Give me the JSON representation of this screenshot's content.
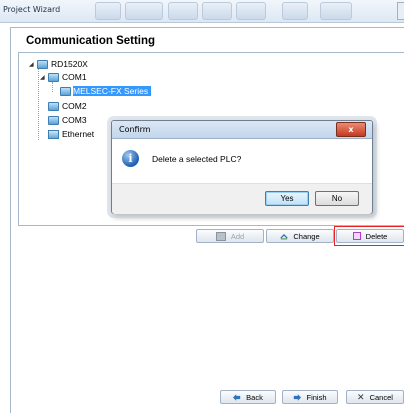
{
  "window": {
    "title": "Project Wizard"
  },
  "section": {
    "title": "Communication Setting"
  },
  "tree": {
    "root": "RD1520X",
    "com1": "COM1",
    "child_selected": "MELSEC-FX Series",
    "com2": "COM2",
    "com3": "COM3",
    "ethernet": "Ethernet"
  },
  "actions": {
    "add": "Add",
    "change": "Change",
    "delete": "Delete"
  },
  "dialog": {
    "title": "Confirm",
    "close": "x",
    "message": "Delete a selected PLC?",
    "yes": "Yes",
    "no": "No",
    "info_glyph": "i"
  },
  "nav": {
    "back": "Back",
    "finish": "Finish",
    "cancel": "Cancel"
  },
  "colors": {
    "selection": "#3399ff",
    "highlight_box": "#e22222",
    "dialog_close": "#c43b1f"
  },
  "icons": {
    "tree_node": "plc-port-icon",
    "ethernet": "ethernet-icon",
    "add": "add-icon",
    "change": "change-icon",
    "delete": "delete-icon",
    "back": "back-arrow-icon",
    "finish": "finish-arrow-icon",
    "cancel": "cancel-x-icon",
    "info": "info-icon"
  }
}
